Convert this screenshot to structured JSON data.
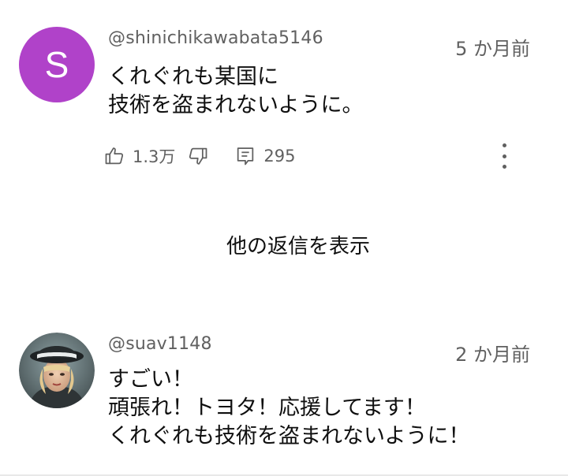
{
  "comments": [
    {
      "handle": "@shinichikawabata5146",
      "time": "5 か月前",
      "avatar_letter": "S",
      "avatar_color": "#b042c9",
      "body_lines": [
        "くれぐれも某国に",
        "技術を盗まれないように。"
      ],
      "likes": "1.3万",
      "replies": "295"
    },
    {
      "handle": "@suav1148",
      "time": "2 か月前",
      "avatar_image": "portrait-with-hat",
      "body_lines": [
        "すごい！",
        "頑張れ！トヨタ！応援してます！",
        "くれぐれも技術を盗まれないように！"
      ]
    }
  ],
  "show_replies_label": "他の返信を表示",
  "icons": {
    "like": "thumbs-up-icon",
    "dislike": "thumbs-down-icon",
    "reply": "comment-icon",
    "more": "more-vertical-icon"
  },
  "colors": {
    "text_primary": "#0f0f0f",
    "text_secondary": "#606060"
  }
}
